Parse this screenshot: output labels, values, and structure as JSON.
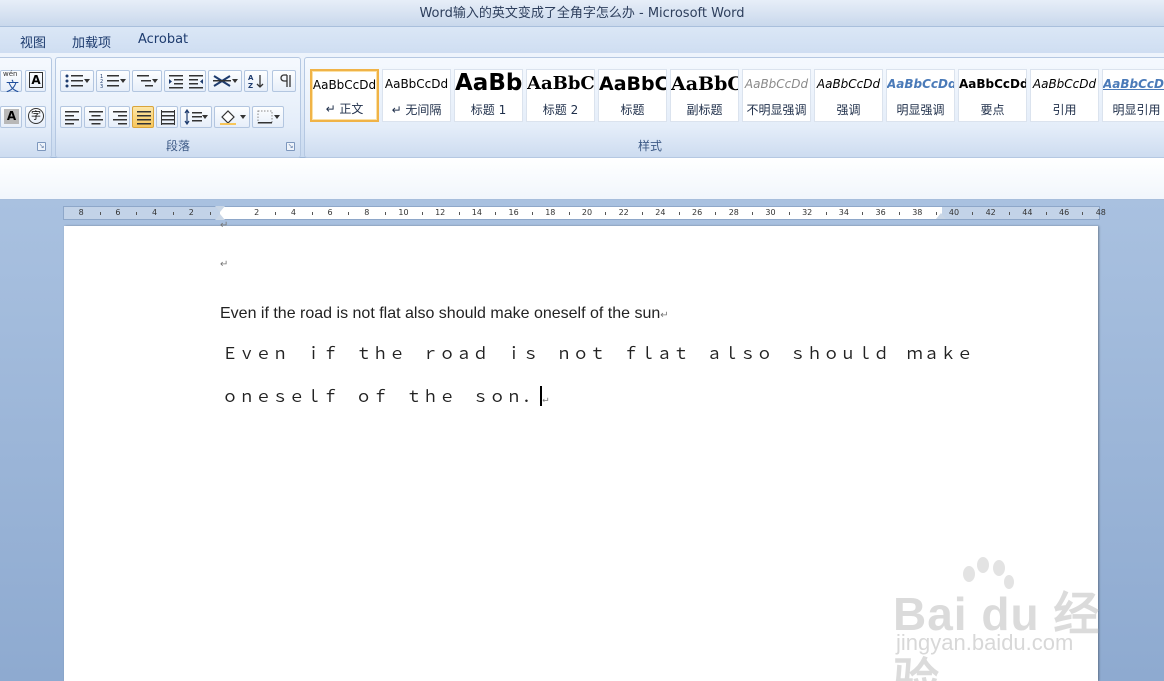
{
  "window": {
    "title": "Word输入的英文变成了全角字怎么办 - Microsoft Word"
  },
  "tabs": [
    {
      "label": "视图"
    },
    {
      "label": "加载项"
    },
    {
      "label": "Acrobat"
    }
  ],
  "ribbon": {
    "font_group": {
      "phonetic_label": "wén",
      "phonetic_char": "文",
      "border_char": "A",
      "highlight_char": "A",
      "enclose_char": "字"
    },
    "paragraph_group": {
      "label": "段落"
    },
    "styles_group": {
      "label": "样式",
      "styles": [
        {
          "sample": "AaBbCcDd",
          "name": "↵ 正文"
        },
        {
          "sample": "AaBbCcDd",
          "name": "↵ 无间隔"
        },
        {
          "sample": "AaBb",
          "name": "标题 1"
        },
        {
          "sample": "AaBbC",
          "name": "标题 2"
        },
        {
          "sample": "AaBbC",
          "name": "标题"
        },
        {
          "sample": "AaBbC",
          "name": "副标题"
        },
        {
          "sample": "AaBbCcDd",
          "name": "不明显强调"
        },
        {
          "sample": "AaBbCcDd",
          "name": "强调"
        },
        {
          "sample": "AaBbCcDd",
          "name": "明显强调"
        },
        {
          "sample": "AaBbCcDd",
          "name": "要点"
        },
        {
          "sample": "AaBbCcDd",
          "name": "引用"
        },
        {
          "sample": "AaBbCcDd",
          "name": "明显引用"
        }
      ]
    }
  },
  "ruler": {
    "labels": [
      "8",
      "6",
      "4",
      "2",
      "2",
      "4",
      "6",
      "8",
      "10",
      "12",
      "14",
      "16",
      "18",
      "20",
      "22",
      "24",
      "26",
      "28",
      "30",
      "32",
      "34",
      "36",
      "38",
      "40",
      "42",
      "44",
      "46",
      "48"
    ]
  },
  "document": {
    "para_mark": "↵",
    "line_half": "Even if the road is not flat also should make oneself of the sun",
    "line_full_1": "Ｅｖｅｎ　ｉｆ　ｔｈｅ　ｒｏａｄ　ｉｓ　ｎｏｔ　ｆｌａｔ　ａｌｓｏ　ｓｈｏｕｌｄ　ｍａｋｅ",
    "line_full_2": "ｏｎｅｓｅｌｆ　ｏｆ　ｔｈｅ　ｓｏｎ．"
  },
  "watermark": {
    "brand": "Bai du 经验",
    "url": "jingyan.baidu.com"
  }
}
